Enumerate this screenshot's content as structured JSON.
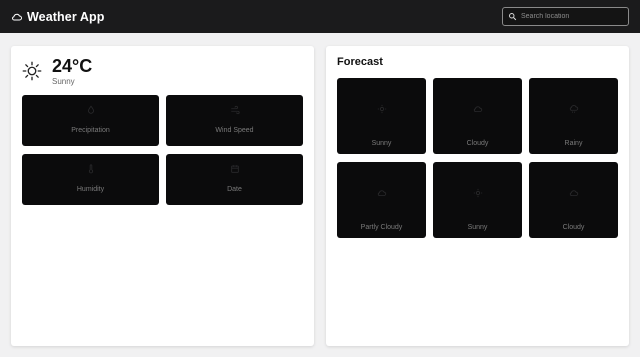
{
  "header": {
    "title": "Weather App",
    "search_placeholder": "Search location"
  },
  "current": {
    "temperature": "24°C",
    "condition": "Sunny",
    "stats": [
      {
        "label": "Precipitation",
        "icon": "droplet-icon"
      },
      {
        "label": "Wind Speed",
        "icon": "wind-icon"
      },
      {
        "label": "Humidity",
        "icon": "thermometer-icon"
      },
      {
        "label": "Date",
        "icon": "calendar-icon"
      }
    ]
  },
  "forecast": {
    "title": "Forecast",
    "days": [
      {
        "label": "Sunny",
        "icon": "sun-icon"
      },
      {
        "label": "Cloudy",
        "icon": "cloud-icon"
      },
      {
        "label": "Rainy",
        "icon": "rain-cloud-icon"
      },
      {
        "label": "Partly Cloudy",
        "icon": "cloud-icon"
      },
      {
        "label": "Sunny",
        "icon": "sun-icon"
      },
      {
        "label": "Cloudy",
        "icon": "cloud-icon"
      }
    ]
  },
  "colors": {
    "header_bg": "#1b1b1c",
    "page_bg": "#f1f1f2",
    "tile_bg": "#0b0b0c",
    "tile_text": "#7a7a7a"
  }
}
